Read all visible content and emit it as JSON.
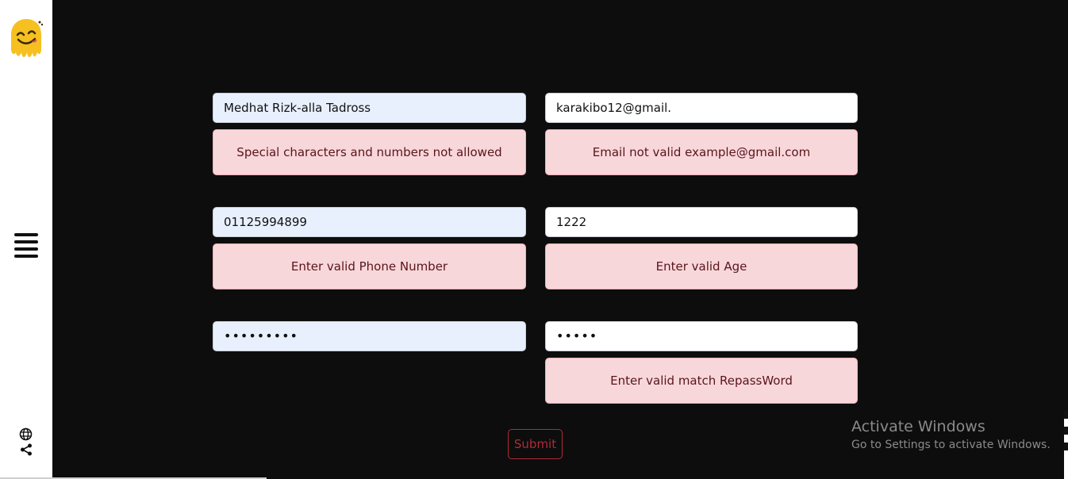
{
  "form": {
    "name_value": "Medhat Rizk-alla Tadross",
    "email_value": "karakibo12@gmail.",
    "phone_value": "01125994899",
    "age_value": "1222",
    "password_value": "•••••••••",
    "repassword_value": "•••••",
    "name_error": "Special characters and numbers not allowed",
    "email_error": "Email not valid example@gmail.com",
    "phone_error": "Enter valid Phone Number",
    "age_error": "Enter valid Age",
    "repassword_error": "Enter valid match RepassWord",
    "submit_label": "Submit"
  },
  "watermark": {
    "title": "Activate Windows",
    "subtitle": "Go to Settings to activate Windows."
  },
  "colors": {
    "background": "#0d0d0d",
    "sidebar": "#ffffff",
    "alert_bg": "#f8d7da",
    "alert_text": "#58151c",
    "autofill_bg": "#e8f0fe",
    "submit": "#b02a37"
  },
  "icons": {
    "logo": "yummy-face-logo",
    "menu": "hamburger-icon",
    "language": "globe-icon",
    "share": "share-icon"
  }
}
